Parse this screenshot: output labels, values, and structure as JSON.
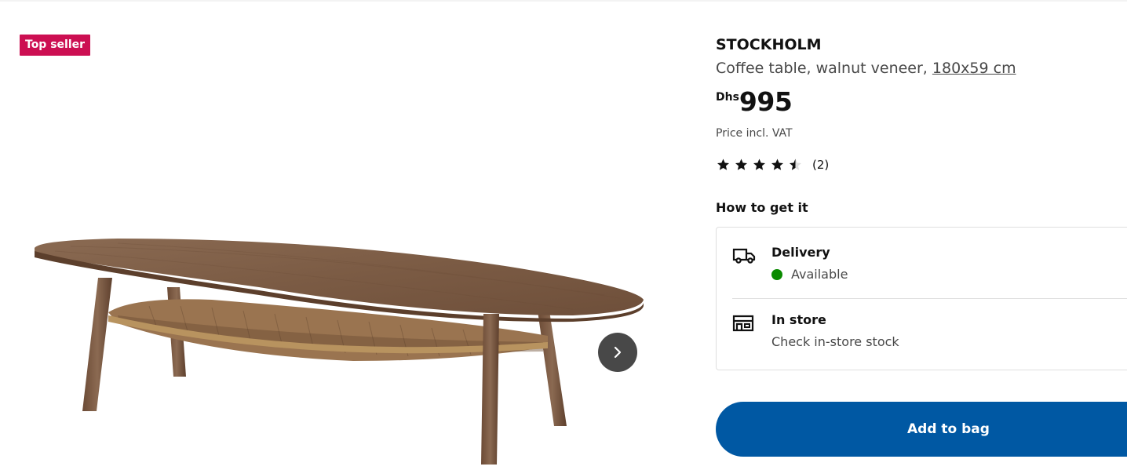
{
  "gallery": {
    "badge": "Top seller",
    "next_icon": "chevron-right-icon"
  },
  "product": {
    "name": "STOCKHOLM",
    "description_prefix": "Coffee table, walnut veneer, ",
    "size_link": "180x59 cm",
    "currency": "Dhs",
    "price": "995",
    "vat_note": "Price incl. VAT",
    "rating_value": 4.5,
    "rating_max": 5,
    "rating_count": "(2)"
  },
  "availability": {
    "title": "How to get it",
    "delivery": {
      "icon": "truck-icon",
      "title": "Delivery",
      "status": "Available",
      "status_color": "#0a8a00"
    },
    "store": {
      "icon": "store-icon",
      "title": "In store",
      "link": "Check in-store stock"
    }
  },
  "actions": {
    "add_to_bag": "Add to bag",
    "button_color": "#0058a3"
  },
  "colors": {
    "badge": "#cc0f52",
    "accent": "#0058a3"
  }
}
